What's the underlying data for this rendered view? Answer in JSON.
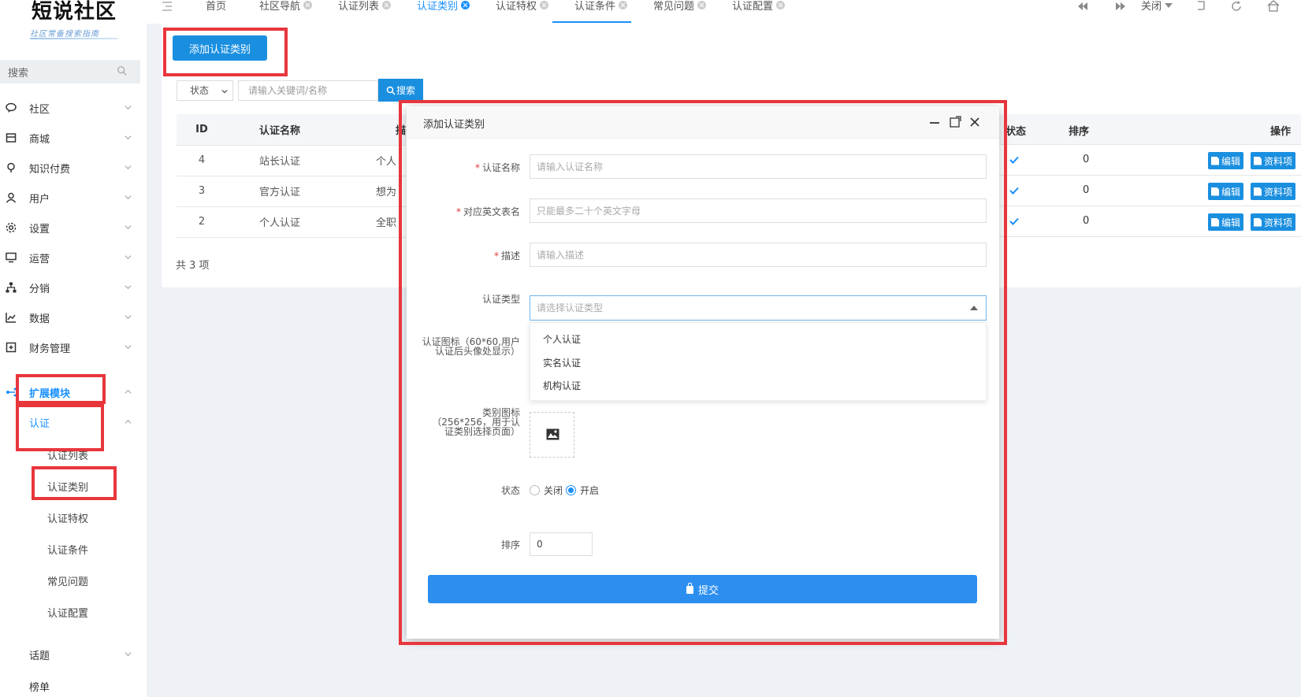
{
  "logo": {
    "title": "短说社区",
    "subtitle": "社区常备搜索指南"
  },
  "sidebar": {
    "search_placeholder": "搜索",
    "items": [
      {
        "label": "社区",
        "icon": "chat-icon"
      },
      {
        "label": "商城",
        "icon": "store-icon"
      },
      {
        "label": "知识付费",
        "icon": "bulb-icon"
      },
      {
        "label": "用户",
        "icon": "user-icon"
      },
      {
        "label": "设置",
        "icon": "gear-icon"
      },
      {
        "label": "运营",
        "icon": "monitor-icon"
      },
      {
        "label": "分销",
        "icon": "sitemap-icon"
      },
      {
        "label": "数据",
        "icon": "chart-icon"
      },
      {
        "label": "财务管理",
        "icon": "ledger-icon"
      },
      {
        "label": "扩展模块",
        "icon": "extension-icon"
      }
    ],
    "sub_parent": "认证",
    "sub_items": [
      "认证列表",
      "认证类别",
      "认证特权",
      "认证条件",
      "常见问题",
      "认证配置"
    ],
    "tail_items": [
      "话题",
      "榜单"
    ]
  },
  "tabs": [
    "首页",
    "社区导航",
    "认证列表",
    "认证类别",
    "认证特权",
    "认证条件",
    "常见问题",
    "认证配置"
  ],
  "toolbar": {
    "close_label": "关闭"
  },
  "page": {
    "add_button": "添加认证类别",
    "status_filter": "状态",
    "keyword_placeholder": "请输入关键词/名称",
    "search_button": "搜索",
    "table": {
      "headers": [
        "ID",
        "认证名称",
        "描"
      ],
      "rows": [
        {
          "id": "4",
          "name": "站长认证",
          "desc": "个人"
        },
        {
          "id": "3",
          "name": "官方认证",
          "desc": "想为"
        },
        {
          "id": "2",
          "name": "个人认证",
          "desc": "全职"
        }
      ],
      "right_headers": [
        "状态",
        "排序",
        "操作"
      ],
      "sort_values": [
        "0",
        "0",
        "0"
      ],
      "edit_label": "编辑",
      "fields_label": "资料项"
    },
    "total": "共 3 项"
  },
  "modal": {
    "title": "添加认证类别",
    "fields": {
      "name_label": "认证名称",
      "name_placeholder": "请输入认证名称",
      "table_label": "对应英文表名",
      "table_placeholder": "只能最多二十个英文字母",
      "desc_label": "描述",
      "desc_placeholder": "请输入描述",
      "type_label": "认证类型",
      "type_placeholder": "请选择认证类型",
      "type_options": [
        "个人认证",
        "实名认证",
        "机构认证"
      ],
      "icon_label": "认证图标（60*60,用户认证后头像处显示）",
      "cat_icon_label": "类别图标（256*256，用于认证类别选择页面）",
      "status_label": "状态",
      "status_off": "关闭",
      "status_on": "开启",
      "sort_label": "排序",
      "sort_value": "0"
    },
    "submit": "提交"
  }
}
